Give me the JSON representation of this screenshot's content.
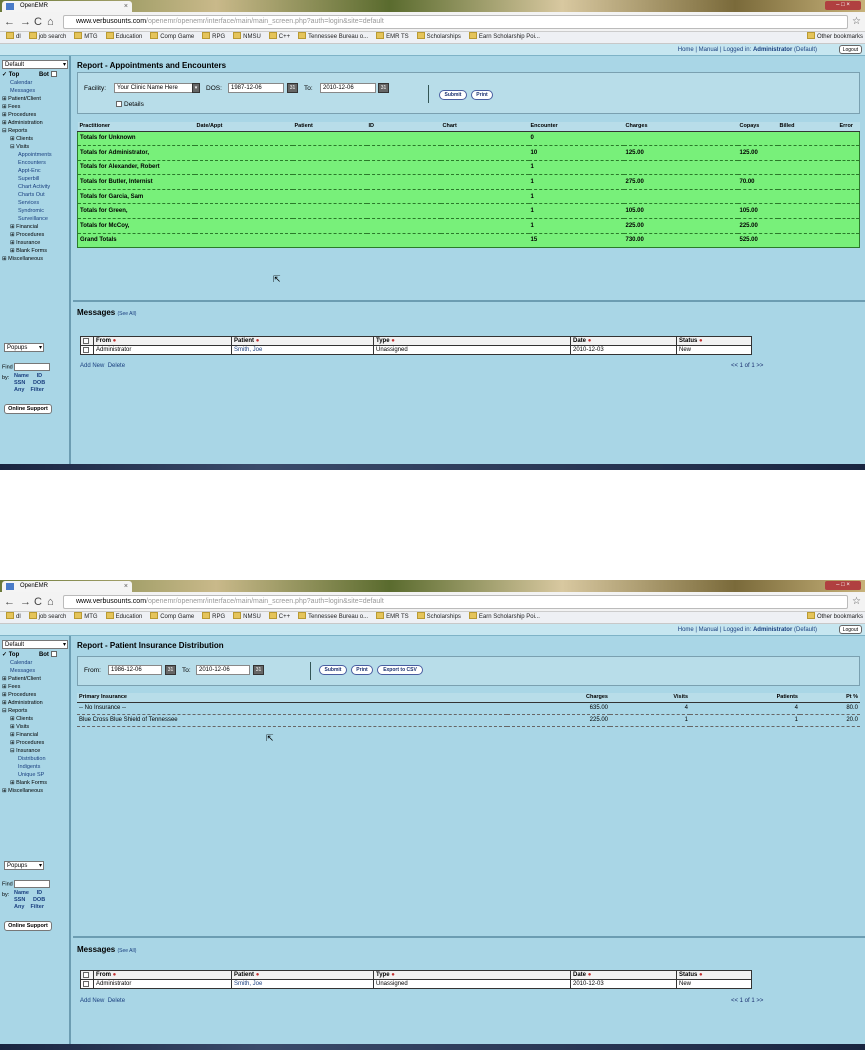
{
  "browser": {
    "tab_title": "OpenEMR",
    "url_host": "www.verbusounts.com",
    "url_path": "/openemr/openemr/interface/main/main_screen.php?auth=login&site=default",
    "bookmarks": [
      "dl",
      "job search",
      "MTG",
      "Education",
      "Comp Game",
      "RPG",
      "NMSU",
      "C++",
      "Tennessee Bureau o...",
      "EMR TS",
      "Scholarships",
      "Earn Scholarship Poi..."
    ],
    "other_bookmarks": "Other bookmarks"
  },
  "header": {
    "home": "Home",
    "manual": "Manual",
    "logged_in": "Logged in:",
    "user": "Administrator",
    "group": "(Default)",
    "logout": "Logout"
  },
  "sidebar": {
    "select_value": "Default",
    "top_label": "Top",
    "bot_label": "Bot",
    "popups": "Popups",
    "find_label": "Find",
    "by_label": "by:",
    "find_opts": [
      "Name",
      "ID",
      "SSN",
      "DOB",
      "Any",
      "Filter"
    ],
    "support": "Online Support",
    "menu1": [
      "Calendar",
      "Messages",
      "⊞ Patient/Client",
      "⊞ Fees",
      "⊞ Procedures",
      "⊞ Administration",
      "⊟ Reports",
      "⊞ Clients",
      "⊟ Visits",
      "Appointments",
      "Encounters",
      "Appt-Enc",
      "Superbill",
      "Chart Activity",
      "Charts Out",
      "Services",
      "Syndromic",
      "Surveillance",
      "⊞ Financial",
      "⊞ Procedures",
      "⊞ Insurance",
      "⊞ Blank Forms",
      "⊞ Miscellaneous"
    ],
    "menu2": [
      "Calendar",
      "Messages",
      "⊞ Patient/Client",
      "⊞ Fees",
      "⊞ Procedures",
      "⊞ Administration",
      "⊟ Reports",
      "⊞ Clients",
      "⊞ Visits",
      "⊞ Financial",
      "⊞ Procedures",
      "⊟ Insurance",
      "Distribution",
      "Indigents",
      "Unique SP",
      "⊞ Blank Forms",
      "⊞ Miscellaneous"
    ]
  },
  "report1": {
    "title": "Report - Appointments and Encounters",
    "facility_label": "Facility:",
    "facility_value": "Your Clinic Name Here",
    "dos_label": "DOS:",
    "dos_from": "1987-12-06",
    "to_label": "To:",
    "dos_to": "2010-12-06",
    "details_label": "Details",
    "submit": "Submit",
    "print": "Print",
    "columns": [
      "Practitioner",
      "Date/Appt",
      "Patient",
      "ID",
      "Chart",
      "Encounter",
      "Charges",
      "Copays",
      "Billed",
      "Error"
    ],
    "rows": [
      {
        "name": "Totals for Unknown",
        "enc": "0",
        "charges": "",
        "copays": ""
      },
      {
        "name": "Totals for Administrator,",
        "enc": "10",
        "charges": "125.00",
        "copays": "125.00"
      },
      {
        "name": "Totals for Alexander, Robert",
        "enc": "1",
        "charges": "",
        "copays": ""
      },
      {
        "name": "Totals for Butler, Internist",
        "enc": "1",
        "charges": "275.00",
        "copays": "70.00"
      },
      {
        "name": "Totals for Garcia, Sam",
        "enc": "1",
        "charges": "",
        "copays": ""
      },
      {
        "name": "Totals for Green,",
        "enc": "1",
        "charges": "105.00",
        "copays": "105.00"
      },
      {
        "name": "Totals for McCoy,",
        "enc": "1",
        "charges": "225.00",
        "copays": "225.00"
      },
      {
        "name": "Grand Totals",
        "enc": "15",
        "charges": "730.00",
        "copays": "525.00"
      }
    ]
  },
  "report2": {
    "title": "Report - Patient Insurance Distribution",
    "from_label": "From:",
    "from_value": "1986-12-06",
    "to_label": "To:",
    "to_value": "2010-12-06",
    "submit": "Submit",
    "print": "Print",
    "export": "Export to CSV",
    "columns": [
      "Primary Insurance",
      "Charges",
      "Visits",
      "Patients",
      "Pt %"
    ],
    "rows": [
      {
        "ins": "-- No Insurance --",
        "charges": "635.00",
        "visits": "4",
        "patients": "4",
        "pct": "80.0"
      },
      {
        "ins": "Blue Cross Blue Shield of Tennessee",
        "charges": "225.00",
        "visits": "1",
        "patients": "1",
        "pct": "20.0"
      }
    ]
  },
  "messages": {
    "title": "Messages",
    "see_all": "(See All)",
    "columns": [
      "From",
      "Patient",
      "Type",
      "Date",
      "Status"
    ],
    "row": {
      "from": "Administrator",
      "patient": "Smith, Joe",
      "type": "Unassigned",
      "date": "2010-12-03",
      "status": "New"
    },
    "add_new": "Add New",
    "delete": "Delete",
    "pager": "<<  1 of 1  >>"
  }
}
